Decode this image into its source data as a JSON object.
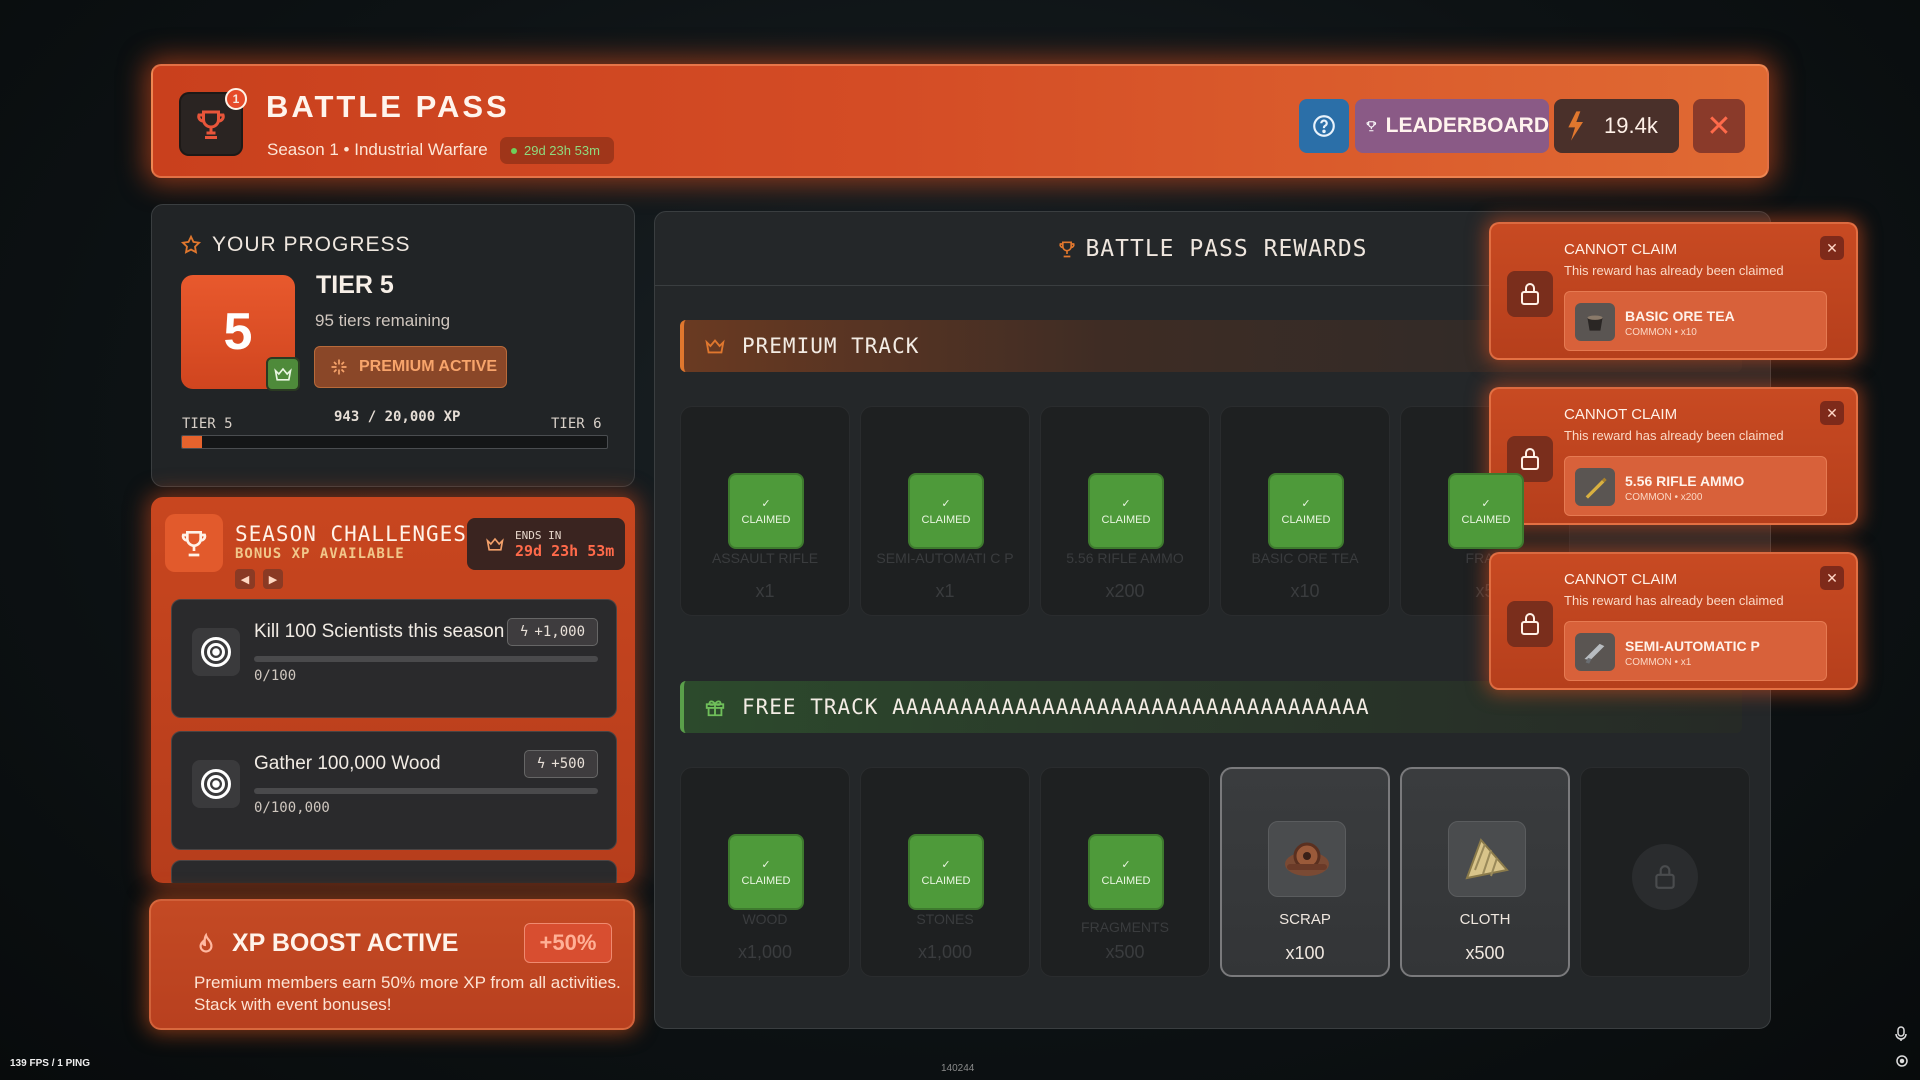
{
  "header": {
    "title": "BATTLE PASS",
    "subtitle": "Season 1 • Industrial Warfare",
    "timer": "29d 23h 53m",
    "notification_count": "1",
    "leaderboard_label": "LEADERBOARD",
    "currency_amount": "19.4k",
    "close_symbol": "✕"
  },
  "progress": {
    "heading": "YOUR PROGRESS",
    "tier_number": "5",
    "tier_label": "TIER 5",
    "tiers_remaining": "95 tiers remaining",
    "premium_label": "PREMIUM ACTIVE",
    "current_tier_label": "TIER 5",
    "next_tier_label": "TIER 6",
    "xp_text": "943 / 20,000 XP",
    "xp_current": 943,
    "xp_target": 20000
  },
  "challenges": {
    "title": "SEASON CHALLENGES",
    "subtitle": "BONUS XP AVAILABLE",
    "ends_label": "ENDS IN",
    "ends_value": "29d 23h 53m",
    "prev_symbol": "◀",
    "next_symbol": "▶",
    "items": [
      {
        "name": "Kill 100 Scientists this season",
        "reward": "+1,000",
        "progress": "0/100"
      },
      {
        "name": "Gather 100,000 Wood",
        "reward": "+500",
        "progress": "0/100,000"
      }
    ]
  },
  "boost": {
    "title": "XP BOOST ACTIVE",
    "badge": "+50%",
    "text": "Premium members earn 50% more XP from all activities. Stack with event bonuses!"
  },
  "rewards": {
    "heading": "BATTLE PASS REWARDS",
    "premium_track_label": "PREMIUM TRACK",
    "free_track_label": "FREE TRACK AAAAAAAAAAAAAAAAAAAAAAAAAAAAAAAAAAA",
    "claimed_label": "CLAIMED",
    "premium_items": [
      {
        "name": "ASSAULT RIFLE",
        "qty": "x1"
      },
      {
        "name": "SEMI-AUTOMATI C P",
        "qty": "x1"
      },
      {
        "name": "5.56 RIFLE AMMO",
        "qty": "x200"
      },
      {
        "name": "BASIC ORE TEA",
        "qty": "x10"
      },
      {
        "name": "FRAG",
        "qty": "x5"
      }
    ],
    "free_items": [
      {
        "name": "WOOD",
        "qty": "x1,000"
      },
      {
        "name": "STONES",
        "qty": "x1,000"
      },
      {
        "name": "FRAGMENTS",
        "qty": "x500"
      },
      {
        "name": "SCRAP",
        "qty": "x100"
      },
      {
        "name": "CLOTH",
        "qty": "x500"
      }
    ]
  },
  "toasts": [
    {
      "title": "CANNOT CLAIM",
      "message": "This reward has already been claimed",
      "item": "BASIC ORE TEA",
      "rarity": "COMMON • x10"
    },
    {
      "title": "CANNOT CLAIM",
      "message": "This reward has already been claimed",
      "item": "5.56 RIFLE AMMO",
      "rarity": "COMMON • x200"
    },
    {
      "title": "CANNOT CLAIM",
      "message": "This reward has already been claimed",
      "item": "SEMI-AUTOMATIC P",
      "rarity": "COMMON • x1"
    }
  ],
  "status": {
    "fps": "139 FPS / 1 PING",
    "build": "140244"
  },
  "colors": {
    "accent": "#d44c25",
    "claimed_green": "#4e9a3a",
    "premium_track": "#e0772e",
    "free_track": "#5aa04a"
  }
}
